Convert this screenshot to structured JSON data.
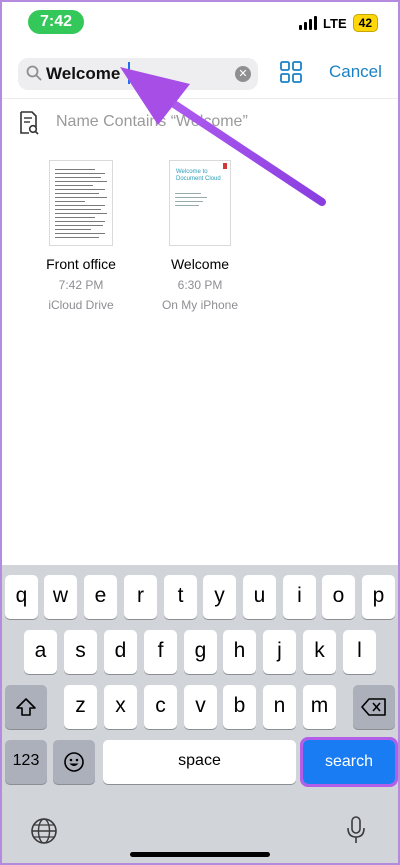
{
  "status": {
    "time": "7:42",
    "network": "LTE",
    "battery": "42"
  },
  "search": {
    "query": "Welcome",
    "cancel_label": "Cancel"
  },
  "suggestion": {
    "text": "Name Contains “Welcome”"
  },
  "files": [
    {
      "name": "Front office",
      "time": "7:42 PM",
      "location": "iCloud Drive"
    },
    {
      "name": "Welcome",
      "time": "6:30 PM",
      "location": "On My iPhone",
      "thumb_title": "Welcome to Document Cloud"
    }
  ],
  "keyboard": {
    "row1": [
      "q",
      "w",
      "e",
      "r",
      "t",
      "y",
      "u",
      "i",
      "o",
      "p"
    ],
    "row2": [
      "a",
      "s",
      "d",
      "f",
      "g",
      "h",
      "j",
      "k",
      "l"
    ],
    "row3": [
      "z",
      "x",
      "c",
      "v",
      "b",
      "n",
      "m"
    ],
    "numbers_label": "123",
    "space_label": "space",
    "search_label": "search"
  },
  "colors": {
    "accent": "#1a82c4",
    "search_key": "#1a7cf2",
    "annotation": "#a64ee6"
  }
}
